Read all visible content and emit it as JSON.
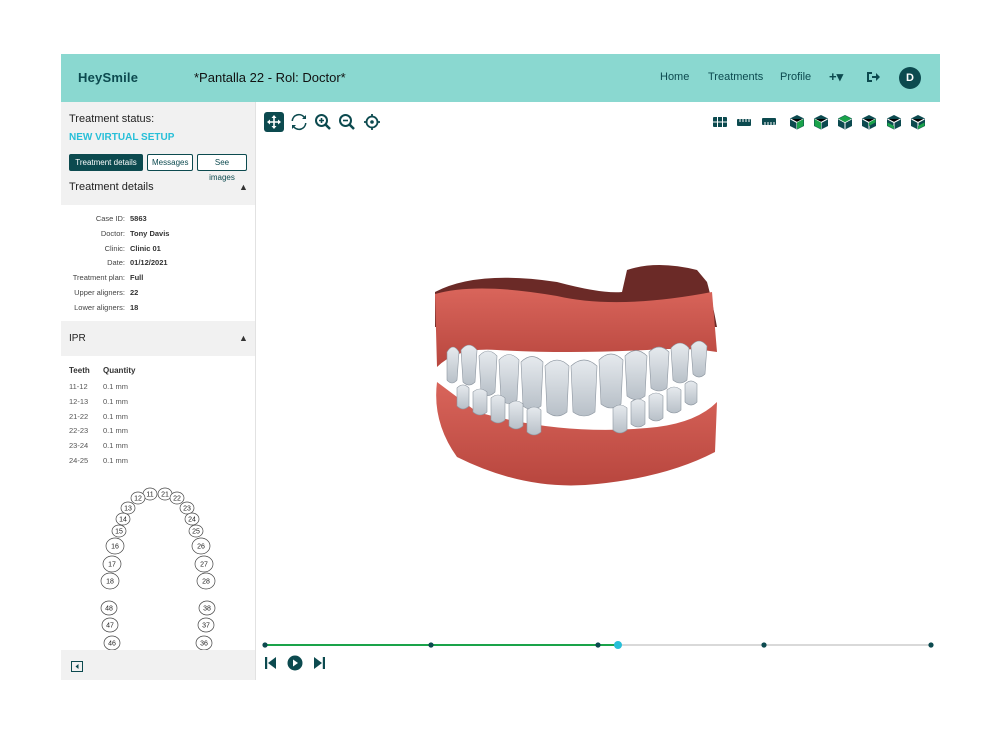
{
  "header": {
    "logo": "HeySmile",
    "title": "*Pantalla 22 - Rol: Doctor*",
    "nav": [
      {
        "label": "Home"
      },
      {
        "label": "Treatments"
      },
      {
        "label": "Profile"
      }
    ],
    "plus_label": "+▾",
    "avatar_initial": "D"
  },
  "sidebar": {
    "status_label": "Treatment status:",
    "status_value": "NEW VIRTUAL SETUP",
    "buttons": {
      "details": "Treatment details",
      "messages": "Messages",
      "images": "See images"
    },
    "details_title": "Treatment details",
    "details": [
      {
        "key": "Case ID:",
        "value": "5863"
      },
      {
        "key": "Doctor:",
        "value": "Tony Davis"
      },
      {
        "key": "Clinic:",
        "value": "Clinic 01"
      },
      {
        "key": "Date:",
        "value": "01/12/2021"
      },
      {
        "key": "Treatment plan:",
        "value": "Full"
      },
      {
        "key": "Upper aligners:",
        "value": "22"
      },
      {
        "key": "Lower aligners:",
        "value": "18"
      }
    ],
    "ipr_title": "IPR",
    "ipr_headers": {
      "teeth": "Teeth",
      "quantity": "Quantity"
    },
    "ipr_rows": [
      {
        "teeth": "11-12",
        "quantity": "0.1 mm"
      },
      {
        "teeth": "12-13",
        "quantity": "0.1 mm"
      },
      {
        "teeth": "21-22",
        "quantity": "0.1 mm"
      },
      {
        "teeth": "22-23",
        "quantity": "0.1 mm"
      },
      {
        "teeth": "23-24",
        "quantity": "0.1 mm"
      },
      {
        "teeth": "24-25",
        "quantity": "0.1 mm"
      }
    ],
    "tooth_chart": {
      "upper": [
        "11",
        "12",
        "13",
        "14",
        "15",
        "16",
        "17",
        "18",
        "21",
        "22",
        "23",
        "24",
        "25",
        "26",
        "27",
        "28"
      ],
      "lower": [
        "48",
        "47",
        "46",
        "38",
        "37",
        "36"
      ]
    }
  },
  "viewer": {
    "tools_left": [
      "move-icon",
      "rotate-icon",
      "zoom-in-icon",
      "zoom-out-icon",
      "center-icon"
    ],
    "tools_right": [
      "grid-view-icon",
      "upper-ruler-icon",
      "lower-ruler-icon",
      "cube-front-icon",
      "cube-back-icon",
      "cube-left-icon",
      "cube-right-icon",
      "cube-top-icon",
      "cube-bottom-icon"
    ],
    "timeline": {
      "progress": 0.53,
      "stages": 5
    },
    "colors": {
      "accent": "#27bfd8",
      "brand": "#0c4a4f",
      "header": "#8ad8d0",
      "gum": "#c9534a",
      "track_done": "#1aa34a"
    }
  }
}
